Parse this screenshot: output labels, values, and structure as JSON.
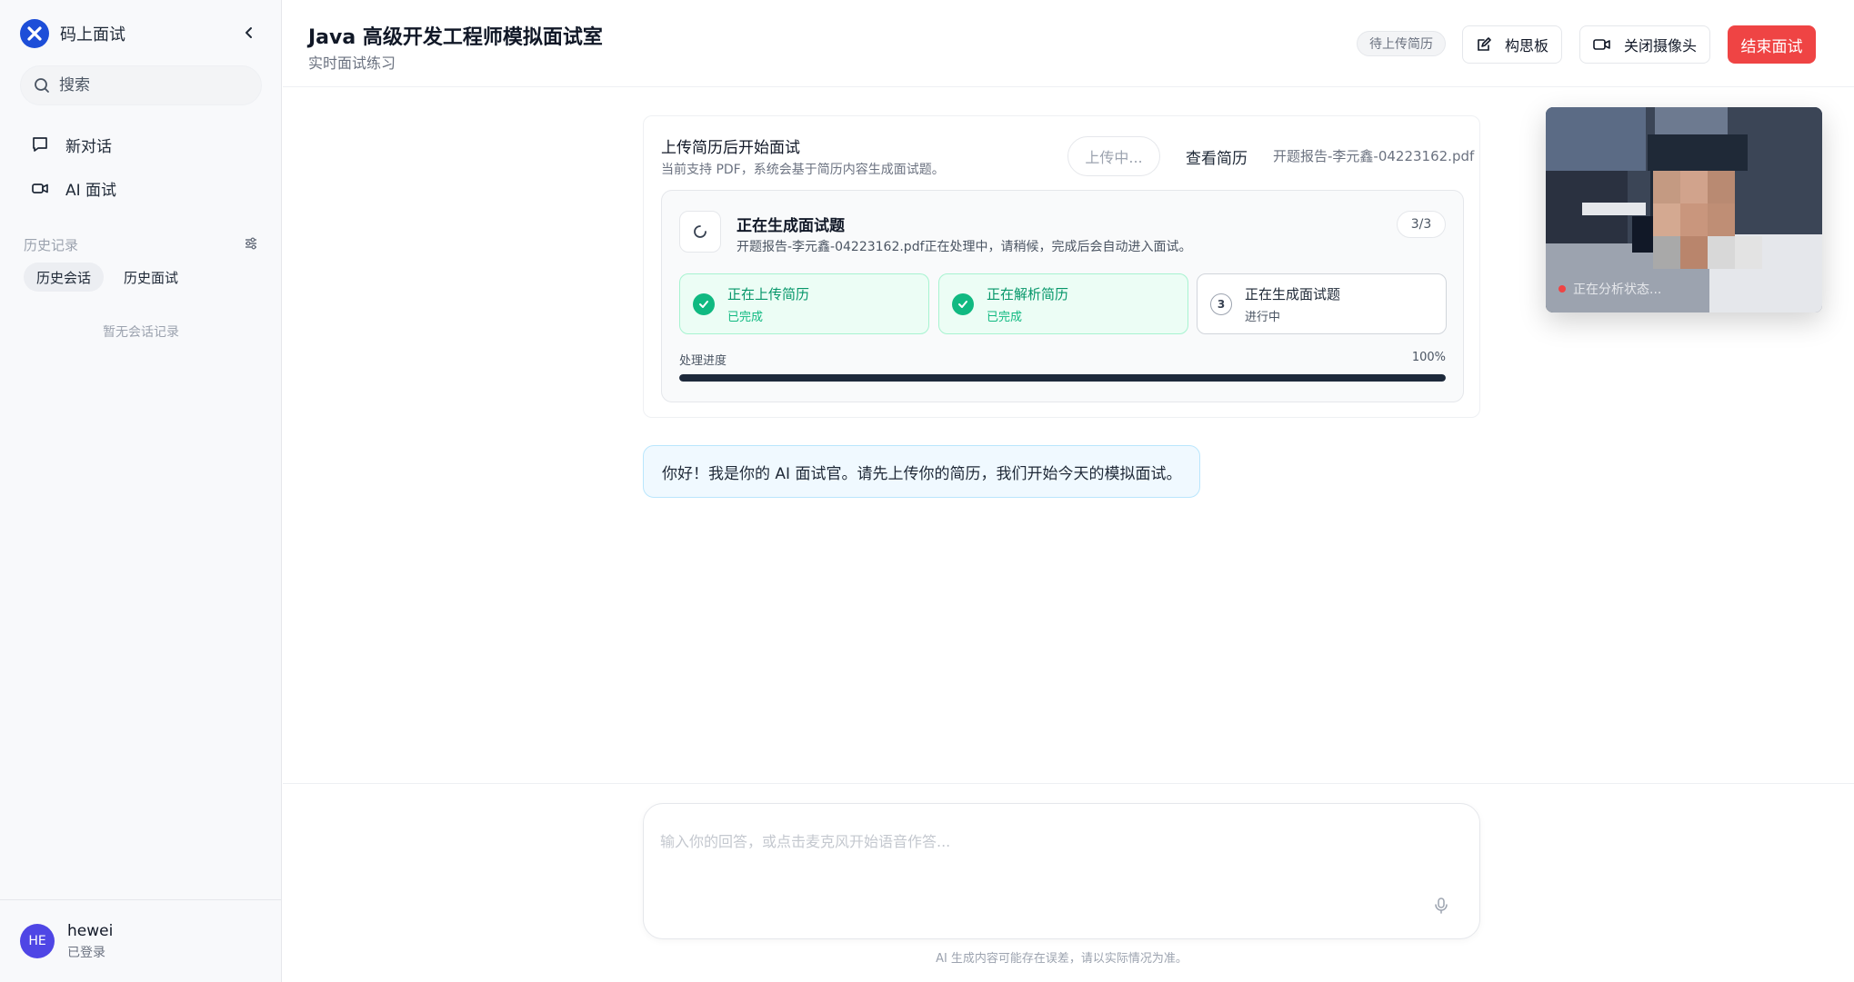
{
  "sidebar": {
    "brand_name": "码上面试",
    "search_placeholder": "搜索",
    "nav": [
      {
        "label": "新对话",
        "icon": "chat-bubble-icon"
      },
      {
        "label": "AI 面试",
        "icon": "video-camera-icon"
      }
    ],
    "history_title": "历史记录",
    "history_tabs": [
      "历史会话",
      "历史面试"
    ],
    "active_history_tab": 0,
    "empty_text": "暂无会话记录",
    "user": {
      "initials": "HE",
      "name": "hewei",
      "status": "已登录"
    }
  },
  "header": {
    "title": "Java 高级开发工程师模拟面试室",
    "subtitle": "实时面试练习",
    "status_badge": "待上传简历",
    "whiteboard_label": "构思板",
    "camera_label": "关闭摄像头",
    "end_label": "结束面试"
  },
  "upload": {
    "title": "上传简历后开始面试",
    "subtitle": "当前支持 PDF，系统会基于简历内容生成面试题。",
    "uploading_label": "上传中...",
    "view_label": "查看简历",
    "file_name": "开题报告-李元鑫-04223162.pdf",
    "generation": {
      "title": "正在生成面试题",
      "description": "开题报告-李元鑫-04223162.pdf正在处理中，请稍候，完成后会自动进入面试。",
      "count": "3/3",
      "steps": [
        {
          "title": "正在上传简历",
          "status": "已完成",
          "state": "done"
        },
        {
          "title": "正在解析简历",
          "status": "已完成",
          "state": "done"
        },
        {
          "title": "正在生成面试题",
          "status": "进行中",
          "state": "active",
          "number": "3"
        }
      ],
      "progress_label": "处理进度",
      "progress_text": "100%",
      "progress_value": 1.0
    }
  },
  "chat": {
    "ai_message": "你好！我是你的 AI 面试官。请先上传你的简历，我们开始今天的模拟面试。"
  },
  "camera": {
    "status": "正在分析状态..."
  },
  "composer": {
    "placeholder": "输入你的回答，或点击麦克风开始语音作答...",
    "disclaimer": "AI 生成内容可能存在误差，请以实际情况为准。"
  },
  "colors": {
    "accent": "#1d4ed8",
    "danger": "#ef4444",
    "success": "#10b981",
    "avatar": "#4f46e5"
  }
}
